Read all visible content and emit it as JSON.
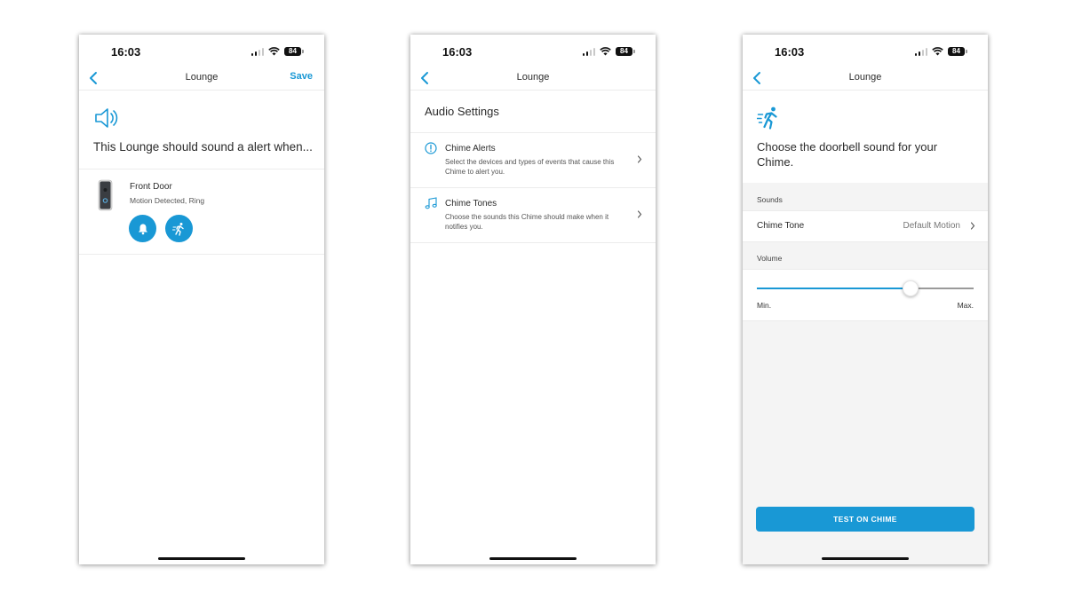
{
  "colors": {
    "accent": "#1998d5",
    "text": "#2b2b2b",
    "band": "#f4f4f4"
  },
  "status_bar": {
    "time": "16:03",
    "battery": "84"
  },
  "screens": [
    {
      "nav": {
        "title": "Lounge",
        "save": "Save"
      },
      "heading": "This Lounge should sound a alert when...",
      "device": {
        "name": "Front Door",
        "subtitle": "Motion Detected, Ring",
        "toggles": [
          "bell-icon",
          "motion-icon"
        ]
      }
    },
    {
      "nav": {
        "title": "Lounge"
      },
      "section_title": "Audio Settings",
      "rows": [
        {
          "icon": "info-icon",
          "title": "Chime Alerts",
          "description": "Select the devices and types of events that cause this Chime to alert you."
        },
        {
          "icon": "music-note-icon",
          "title": "Chime Tones",
          "description": "Choose the sounds this Chime should make when it notifies you."
        }
      ]
    },
    {
      "nav": {
        "title": "Lounge"
      },
      "heading": "Choose the doorbell sound for your Chime.",
      "sounds_label": "Sounds",
      "chime_tone": {
        "label": "Chime Tone",
        "value": "Default Motion"
      },
      "volume": {
        "label": "Volume",
        "level": 0.71,
        "min_label": "Min.",
        "max_label": "Max."
      },
      "test_button": "TEST ON CHIME"
    }
  ]
}
